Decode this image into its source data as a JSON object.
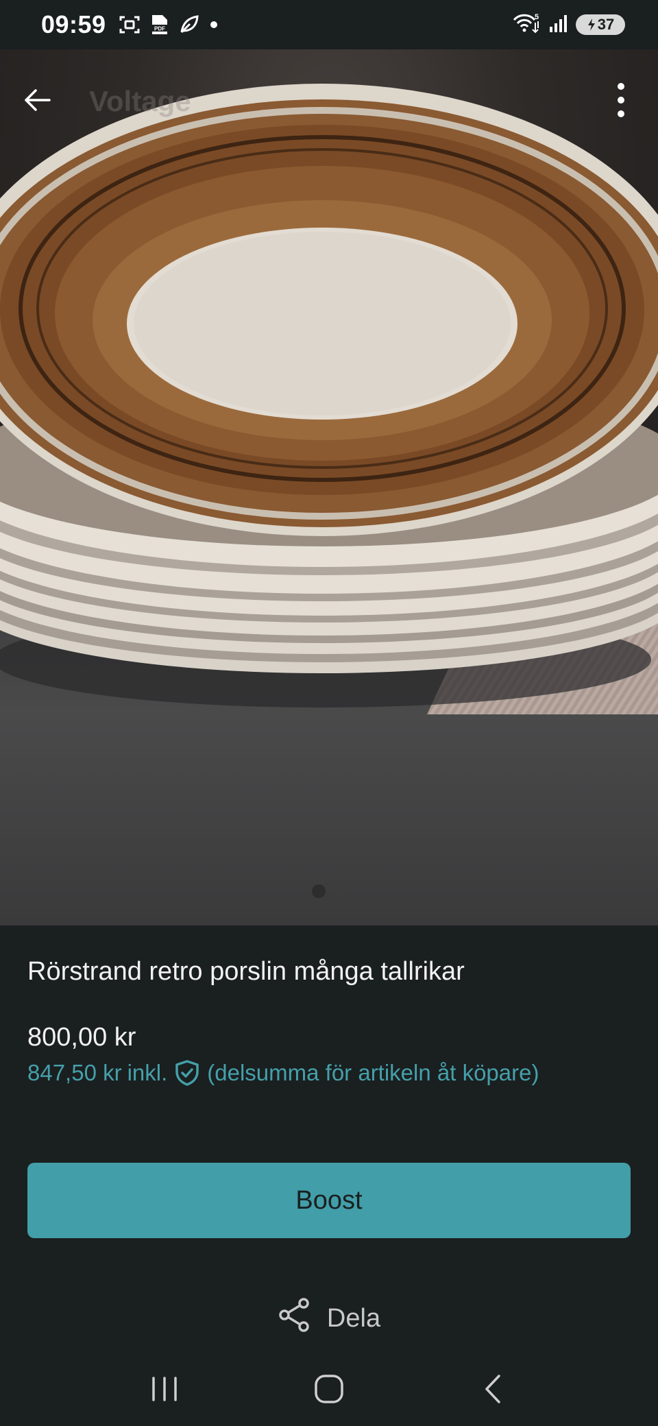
{
  "status_bar": {
    "time": "09:59",
    "icons": [
      "screenshot-icon",
      "pdf-icon",
      "leaf-icon",
      "dot-icon"
    ],
    "right_icons": [
      "wifi-icon",
      "signal-icon",
      "battery-icon"
    ],
    "wifi_label": "5",
    "battery_level": "37"
  },
  "header": {
    "back_icon": "arrow-left-icon",
    "more_icon": "more-vertical-icon"
  },
  "gallery": {
    "image_count": 2,
    "active_index": 0,
    "image_subject": "stack of brown-rimmed retro porcelain plates"
  },
  "listing": {
    "title": "Rörstrand retro porslin många tallrikar",
    "price": "800,00 kr",
    "buyer_price": "847,50 kr",
    "buyer_price_incl": "inkl.",
    "buyer_price_note": "(delsumma för artikeln åt köpare)",
    "buyer_protection_icon": "shield-check-icon"
  },
  "actions": {
    "boost_label": "Boost",
    "share_label": "Dela",
    "share_icon": "share-icon"
  },
  "nav_bar": {
    "items": [
      "recent-apps-icon",
      "home-icon",
      "back-icon"
    ]
  },
  "colors": {
    "background": "#1a1f20",
    "accent": "#429ea8",
    "accent_text": "#45a0aa"
  }
}
